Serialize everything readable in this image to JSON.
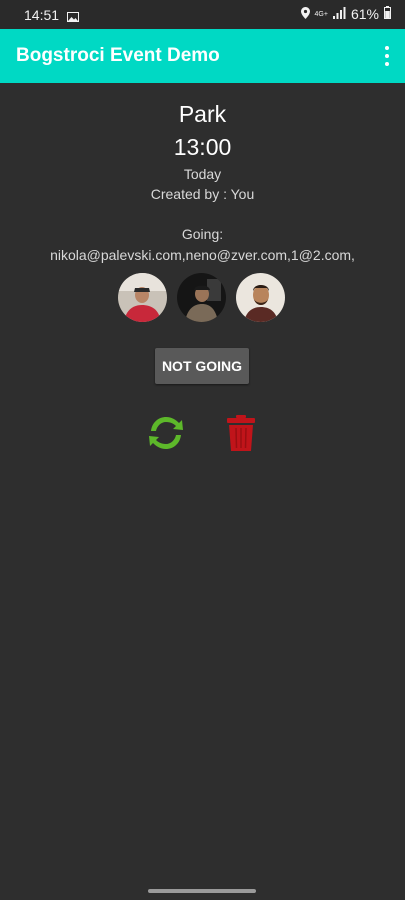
{
  "status_bar": {
    "time": "14:51",
    "network": "4G+",
    "battery": "61%",
    "icons": [
      "gallery-icon",
      "location-icon",
      "signal-icon",
      "battery-icon"
    ]
  },
  "app_bar": {
    "title": "Bogstroci Event Demo",
    "background": "#00d9c4",
    "menu_icon": "overflow-menu-icon"
  },
  "event": {
    "title": "Park",
    "time": "13:00",
    "day": "Today",
    "created_by": "Created by : You",
    "going_label": "Going:",
    "going_list": "nikola@palevski.com,neno@zver.com,1@2.com,",
    "attendees": [
      "nikola@palevski.com",
      "neno@zver.com",
      "1@2.com"
    ]
  },
  "actions": {
    "not_going_label": "NOT GOING",
    "refresh_icon": "refresh-icon",
    "delete_icon": "trash-icon",
    "refresh_color": "#5db82a",
    "delete_color": "#c0141a"
  }
}
